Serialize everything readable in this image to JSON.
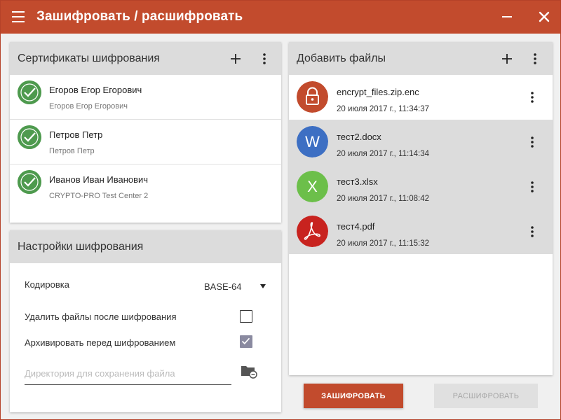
{
  "window": {
    "title": "Зашифровать / расшифровать"
  },
  "certificates": {
    "title": "Сертификаты шифрования",
    "items": [
      {
        "name": "Егоров Егор Егорович",
        "issuer": "Егоров Егор Егорович"
      },
      {
        "name": "Петров Петр",
        "issuer": "Петров Петр"
      },
      {
        "name": "Иванов Иван Иванович",
        "issuer": "CRYPTO-PRO Test Center 2"
      }
    ]
  },
  "settings": {
    "title": "Настройки шифрования",
    "encoding_label": "Кодировка",
    "encoding_value": "BASE-64",
    "delete_label": "Удалить файлы после шифрования",
    "delete_checked": false,
    "archive_label": "Архивировать перед шифрованием",
    "archive_checked": true,
    "directory_placeholder": "Директория для сохранения файла",
    "directory_value": ""
  },
  "files": {
    "title": "Добавить файлы",
    "items": [
      {
        "name": "encrypt_files.zip.enc",
        "date": "20 июля 2017 г., 11:34:37",
        "icon": "lock-icon",
        "letter": "",
        "color": "#c24b2d",
        "selected": false
      },
      {
        "name": "тест2.docx",
        "date": "20 июля 2017 г., 11:14:34",
        "icon": "word-icon",
        "letter": "W",
        "color": "#3d6fc3",
        "selected": true
      },
      {
        "name": "тест3.xlsx",
        "date": "20 июля 2017 г., 11:08:42",
        "icon": "excel-icon",
        "letter": "X",
        "color": "#6cbf4a",
        "selected": true
      },
      {
        "name": "тест4.pdf",
        "date": "20 июля 2017 г., 11:15:32",
        "icon": "pdf-icon",
        "letter": "",
        "color": "#c8231f",
        "selected": true
      }
    ]
  },
  "actions": {
    "encrypt_label": "ЗАШИФРОВАТЬ",
    "decrypt_label": "РАСШИФРОВАТЬ"
  },
  "colors": {
    "accent": "#c24b2d",
    "cert_ok": "#4e9a4e",
    "header_bg": "#dcdcdc"
  }
}
